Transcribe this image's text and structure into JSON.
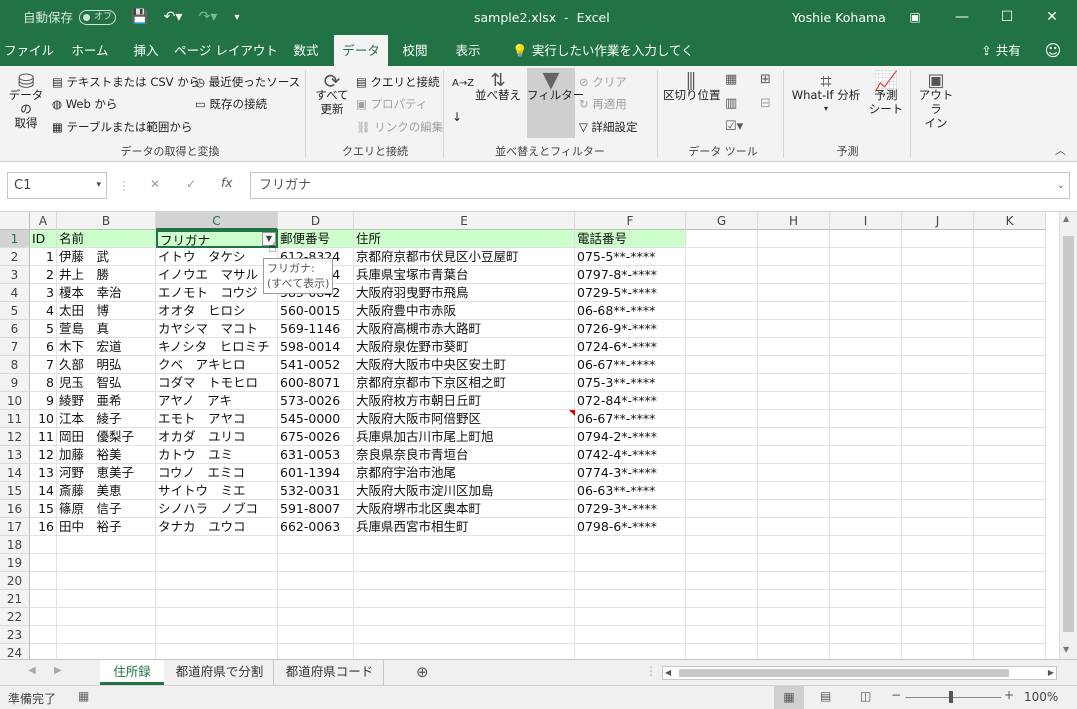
{
  "titlebar": {
    "autosave_label": "自動保存",
    "autosave_state": "オフ",
    "filename": "sample2.xlsx",
    "separator": "-",
    "app": "Excel",
    "user": "Yoshie Kohama"
  },
  "ribbon_tabs": [
    "ファイル",
    "ホーム",
    "挿入",
    "ページ レイアウト",
    "数式",
    "データ",
    "校閲",
    "表示"
  ],
  "active_tab": "データ",
  "tell_me": "実行したい作業を入力してください",
  "share_label": "共有",
  "ribbon": {
    "get_data": "データの\n取得",
    "from_text_csv": "テキストまたは CSV から",
    "from_web": "Web から",
    "from_table": "テーブルまたは範囲から",
    "recent_sources": "最近使ったソース",
    "existing_connections": "既存の接続",
    "group_get_transform": "データの取得と変換",
    "refresh_all": "すべて\n更新",
    "queries_connections": "クエリと接続",
    "properties": "プロパティ",
    "edit_links": "リンクの編集",
    "group_queries": "クエリと接続",
    "sort_az": "A→Z",
    "sort": "並べ替え",
    "filter": "フィルター",
    "clear": "クリア",
    "reapply": "再適用",
    "advanced": "詳細設定",
    "group_sort_filter": "並べ替えとフィルター",
    "text_to_columns": "区切り位置",
    "group_data_tools": "データ ツール",
    "what_if": "What-If 分析",
    "forecast_sheet": "予測\nシート",
    "group_forecast": "予測",
    "outline": "アウトラ\nイン"
  },
  "formula_bar": {
    "name_box": "C1",
    "fx": "fx",
    "content": "フリガナ"
  },
  "columns": [
    "A",
    "B",
    "C",
    "D",
    "E",
    "F",
    "G",
    "H",
    "I",
    "J",
    "K"
  ],
  "selected_column": "C",
  "header_row": [
    "ID",
    "名前",
    "フリガナ",
    "郵便番号",
    "住所",
    "電話番号"
  ],
  "rows": [
    [
      "1",
      "伊藤　武",
      "イトウ　タケシ",
      "612-8324",
      "京都府京都市伏見区小豆屋町",
      "075-5**-****"
    ],
    [
      "2",
      "井上　勝",
      "イノウエ　マサル",
      "665-0014",
      "兵庫県宝塚市青葉台",
      "0797-8*-****"
    ],
    [
      "3",
      "榎本　幸治",
      "エノモト　コウジ",
      "583-0842",
      "大阪府羽曳野市飛鳥",
      "0729-5*-****"
    ],
    [
      "4",
      "太田　博",
      "オオタ　ヒロシ",
      "560-0015",
      "大阪府豊中市赤阪",
      "06-68**-****"
    ],
    [
      "5",
      "萱島　真",
      "カヤシマ　マコト",
      "569-1146",
      "大阪府高槻市赤大路町",
      "0726-9*-****"
    ],
    [
      "6",
      "木下　宏道",
      "キノシタ　ヒロミチ",
      "598-0014",
      "大阪府泉佐野市葵町",
      "0724-6*-****"
    ],
    [
      "7",
      "久部　明弘",
      "クベ　アキヒロ",
      "541-0052",
      "大阪府大阪市中央区安土町",
      "06-67**-****"
    ],
    [
      "8",
      "児玉　智弘",
      "コダマ　トモヒロ",
      "600-8071",
      "京都府京都市下京区相之町",
      "075-3**-****"
    ],
    [
      "9",
      "綾野　亜希",
      "アヤノ　アキ",
      "573-0026",
      "大阪府枚方市朝日丘町",
      "072-84*-****"
    ],
    [
      "10",
      "江本　綾子",
      "エモト　アヤコ",
      "545-0000",
      "大阪府大阪市阿倍野区",
      "06-67**-****"
    ],
    [
      "11",
      "岡田　優梨子",
      "オカダ　ユリコ",
      "675-0026",
      "兵庫県加古川市尾上町旭",
      "0794-2*-****"
    ],
    [
      "12",
      "加藤　裕美",
      "カトウ　ユミ",
      "631-0053",
      "奈良県奈良市青垣台",
      "0742-4*-****"
    ],
    [
      "13",
      "河野　恵美子",
      "コウノ　エミコ",
      "601-1394",
      "京都府宇治市池尾",
      "0774-3*-****"
    ],
    [
      "14",
      "斎藤　美恵",
      "サイトウ　ミエ",
      "532-0031",
      "大阪府大阪市淀川区加島",
      "06-63**-****"
    ],
    [
      "15",
      "篠原　信子",
      "シノハラ　ノブコ",
      "591-8007",
      "大阪府堺市北区奥本町",
      "0729-3*-****"
    ],
    [
      "16",
      "田中　裕子",
      "タナカ　ユウコ",
      "662-0063",
      "兵庫県西宮市相生町",
      "0798-6*-****"
    ]
  ],
  "empty_rows": [
    "18",
    "19",
    "20",
    "21",
    "22",
    "23",
    "24"
  ],
  "tooltip": {
    "line1": "フリガナ:",
    "line2": "(すべて表示)"
  },
  "sheet_tabs": [
    "住所録",
    "都道府県で分割",
    "都道府県コード"
  ],
  "active_sheet": "住所録",
  "status": {
    "ready": "準備完了",
    "zoom": "100%"
  }
}
